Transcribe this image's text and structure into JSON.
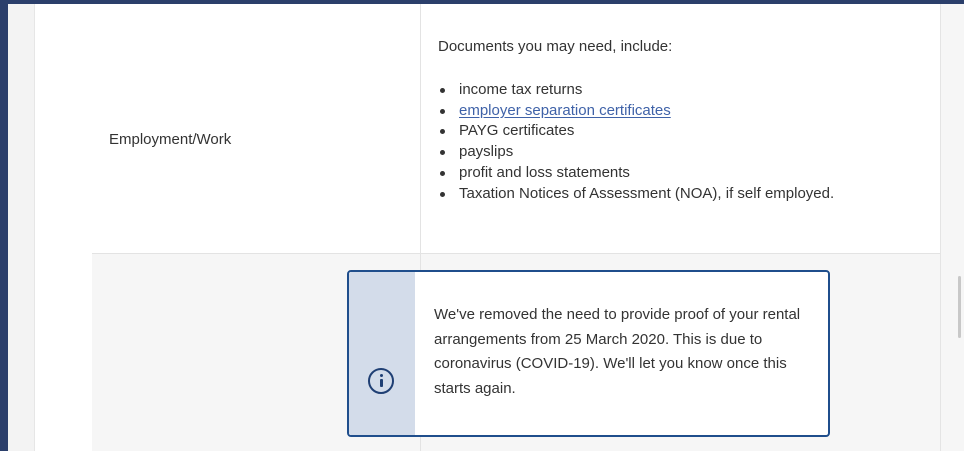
{
  "row_employment": {
    "label": "Employment/Work",
    "intro": "Documents you may need, include:",
    "items": [
      {
        "text": "income tax returns",
        "link": false
      },
      {
        "text": "employer separation certificates",
        "link": true
      },
      {
        "text": "PAYG certificates",
        "link": false
      },
      {
        "text": "payslips",
        "link": false
      },
      {
        "text": "profit and loss statements",
        "link": false
      },
      {
        "text": "Taxation Notices of Assessment (NOA), if self employed.",
        "link": false
      }
    ]
  },
  "row_rental": {
    "label": "",
    "callout": {
      "icon": "info-icon",
      "text": "We've removed the need to provide proof of your rental arrangements from 25 March 2020. This is due to coronavirus (COVID-19). We'll let you know once this starts again."
    }
  },
  "colors": {
    "frame": "#2b3f6b",
    "link": "#3f62a8",
    "callout_border": "#1f4e8c",
    "callout_strip": "#d3dcea",
    "row_alt_bg": "#f6f6f6"
  }
}
